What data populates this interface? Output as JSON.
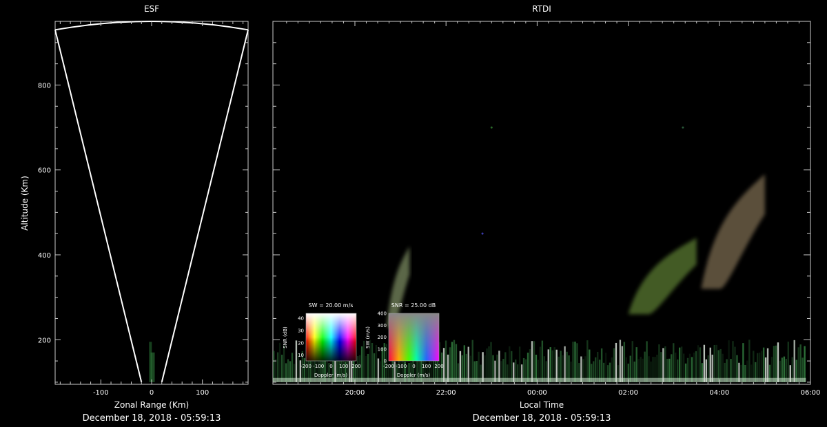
{
  "chart_data": [
    {
      "type": "sector-scan",
      "title": "ESF",
      "xlabel": "Zonal Range (Km)",
      "ylabel": "Altitude (Km)",
      "xlim": [
        -190,
        190
      ],
      "ylim": [
        95,
        950
      ],
      "x_ticks": [
        -100,
        0,
        100
      ],
      "x_tick_labels": [
        "-100",
        "0",
        "100"
      ],
      "y_ticks": [
        200,
        400,
        600,
        800
      ],
      "y_tick_labels": [
        "200",
        "400",
        "600",
        "800"
      ],
      "beam_edges": [
        {
          "ground_x": -20,
          "ground_y": 100,
          "top_x": -190,
          "top_y": 930
        },
        {
          "ground_x": 20,
          "ground_y": 100,
          "top_x": 190,
          "top_y": 930
        }
      ],
      "arc_top_y": 950,
      "date_label": "December 18, 2018 - 05:59:13"
    },
    {
      "type": "heatmap",
      "title": "RTDI",
      "xlabel": "Local Time",
      "ylabel": "",
      "xlim": [
        18.2,
        30.0
      ],
      "ylim": [
        95,
        950
      ],
      "x_ticks": [
        20,
        22,
        24,
        26,
        28,
        30
      ],
      "x_tick_labels": [
        "20:00",
        "22:00",
        "00:00",
        "02:00",
        "04:00",
        "06:00"
      ],
      "y_ticks": [
        200,
        400,
        600,
        800
      ],
      "date_label": "December 18, 2018 - 05:59:13",
      "echo_regions": [
        {
          "t_start": 18.2,
          "t_end": 29.9,
          "alt_low": 100,
          "alt_high": 200
        },
        {
          "t_start": 20.7,
          "t_end": 21.2,
          "alt_low": 230,
          "alt_high": 420
        },
        {
          "t_start": 26.0,
          "t_end": 27.5,
          "alt_low": 260,
          "alt_high": 440
        },
        {
          "t_start": 27.6,
          "t_end": 29.0,
          "alt_low": 320,
          "alt_high": 590
        }
      ],
      "colorbars": [
        {
          "title": "SW = 20.00 m/s",
          "xlabel": "Doppler (m/s)",
          "ylabel": "SNR (dB)",
          "x_tick_labels": [
            "-200",
            "-100",
            "0",
            "100",
            "200"
          ],
          "y_tick_labels": [
            "10",
            "20",
            "30",
            "40"
          ]
        },
        {
          "title": "SNR = 25.00 dB",
          "xlabel": "Doppler (m/s)",
          "ylabel": "SW (m/s)",
          "x_tick_labels": [
            "-200",
            "-100",
            "0",
            "100",
            "200"
          ],
          "y_tick_labels": [
            "0",
            "100",
            "200",
            "300",
            "400"
          ]
        }
      ]
    }
  ]
}
